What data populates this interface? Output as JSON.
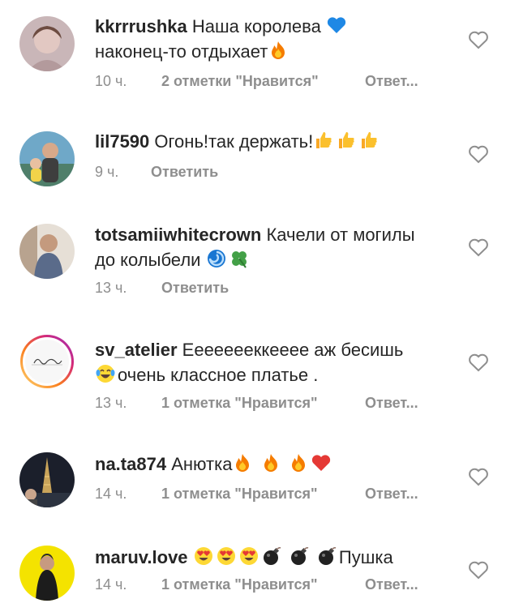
{
  "comments": [
    {
      "username": "kkrrrushka",
      "text_a": "Наша королева",
      "text_b": "наконец-то отдыхает",
      "time": "10 ч.",
      "likes": "2 отметки \"Нравится\"",
      "reply": "Ответ..."
    },
    {
      "username": "lil7590",
      "text_a": "Огонь!так держать!",
      "time": "9 ч.",
      "reply": "Ответить"
    },
    {
      "username": "totsamiiwhitecrown",
      "text_a": "Качели от могилы",
      "text_b": "до колыбели",
      "time": "13 ч.",
      "reply": "Ответить"
    },
    {
      "username": "sv_atelier",
      "text_a": "Еееееееккееее аж бесишь",
      "text_b": "очень классное платье .",
      "time": "13 ч.",
      "likes": "1 отметка \"Нравится\"",
      "reply": "Ответ..."
    },
    {
      "username": "na.ta874",
      "text_a": "Анютка",
      "time": "14 ч.",
      "likes": "1 отметка \"Нравится\"",
      "reply": "Ответ..."
    },
    {
      "username": "maruv.love",
      "text_a": "Пушка",
      "time": "14 ч.",
      "likes": "1 отметка \"Нравится\"",
      "reply": "Ответ..."
    }
  ],
  "icons": {
    "like": "heart-outline-icon",
    "fire": "fire-emoji-icon",
    "blue_heart": "blue-heart-emoji-icon",
    "thumbs_up": "thumbs-up-emoji-icon",
    "cyclone": "cyclone-emoji-icon",
    "clover": "four-leaf-clover-emoji-icon",
    "laughing": "tears-of-joy-emoji-icon",
    "red_heart": "red-heart-emoji-icon",
    "heart_eyes": "heart-eyes-emoji-icon",
    "bomb": "bomb-emoji-icon"
  },
  "colors": {
    "text": "#262626",
    "meta": "#8e8e8e",
    "story_ring": "#d62976"
  }
}
